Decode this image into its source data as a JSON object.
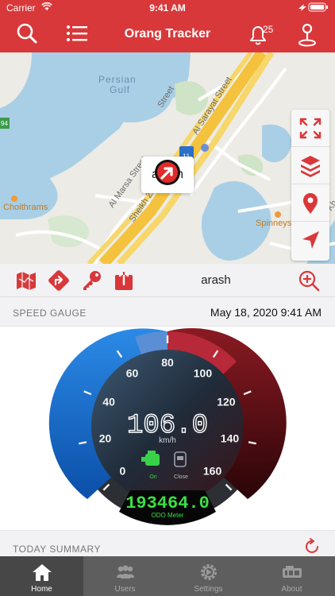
{
  "status_bar": {
    "carrier": "Carrier",
    "time": "9:41 AM"
  },
  "navbar": {
    "title": "Orang Tracker",
    "notification_count": "25",
    "icons": [
      "search-icon",
      "list-icon",
      "bell-icon",
      "location-pin-icon"
    ]
  },
  "map": {
    "labels": {
      "water": "Persian\nGulf",
      "street_1": "Al Sarayat Street",
      "street_2": "Al Marsa Street",
      "street_3": "Sheikh Zayed",
      "street_4": "First Al Kh",
      "street_5": "Street",
      "place_1": "Choithrams",
      "place_2": "Spinneys",
      "route_1": "11",
      "route_2": "94"
    },
    "callout": "arash",
    "tools": [
      "expand-icon",
      "layers-icon",
      "marker-icon",
      "navigate-icon"
    ]
  },
  "action_bar": {
    "device_name": "arash",
    "icons": [
      "map-icon",
      "directions-icon",
      "key-icon",
      "share-icon",
      "zoom-in-icon"
    ]
  },
  "speed_section": {
    "label": "SPEED GAUGE",
    "date": "May 18, 2020 9:41 AM"
  },
  "gauge": {
    "speed": "106.0",
    "unit": "km/h",
    "ticks": [
      "0",
      "20",
      "40",
      "60",
      "80",
      "100",
      "120",
      "140",
      "160"
    ],
    "engine_label": "On",
    "door_label": "Close",
    "odometer": "193464.0",
    "odometer_label": "ODO Meter"
  },
  "summary": {
    "label": "TODAY SUMMARY"
  },
  "tabs": [
    {
      "label": "Home",
      "active": true
    },
    {
      "label": "Users",
      "active": false
    },
    {
      "label": "Settings",
      "active": false
    },
    {
      "label": "About",
      "active": false
    }
  ],
  "colors": {
    "brand": "#d9383a",
    "tabbar": "#5e5e5e",
    "odometer": "#39e046"
  }
}
